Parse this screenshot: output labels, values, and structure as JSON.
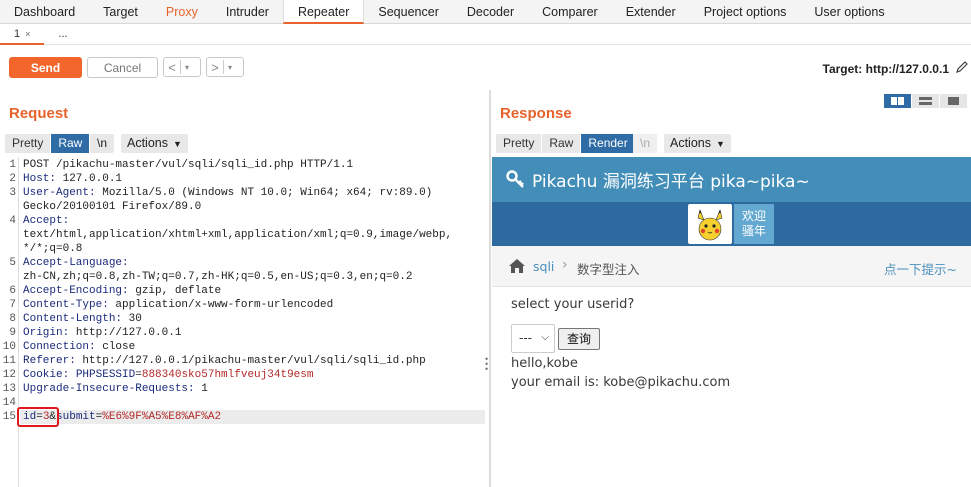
{
  "tabs": [
    {
      "label": "Dashboard",
      "state": "normal"
    },
    {
      "label": "Target",
      "state": "normal"
    },
    {
      "label": "Proxy",
      "state": "highlight"
    },
    {
      "label": "Intruder",
      "state": "normal"
    },
    {
      "label": "Repeater",
      "state": "active"
    },
    {
      "label": "Sequencer",
      "state": "normal"
    },
    {
      "label": "Decoder",
      "state": "normal"
    },
    {
      "label": "Comparer",
      "state": "normal"
    },
    {
      "label": "Extender",
      "state": "normal"
    },
    {
      "label": "Project options",
      "state": "normal"
    },
    {
      "label": "User options",
      "state": "normal"
    }
  ],
  "subtabs": {
    "first": "1",
    "close": "×",
    "more": "..."
  },
  "toolbar": {
    "send": "Send",
    "cancel": "Cancel",
    "back": "<",
    "forward": ">",
    "dropdown": "▾",
    "target_label": "Target: http://127.0.0.1",
    "edit_icon": "pencil-icon"
  },
  "colors": {
    "accent": "#e8632b",
    "selected": "#2f6ba5",
    "highlight_box": "#e0181d"
  },
  "request": {
    "title": "Request",
    "view_modes": [
      "Pretty",
      "Raw"
    ],
    "active_mode": "Raw",
    "newline_toggle": "\\n",
    "actions": "Actions",
    "lines": [
      {
        "n": "1",
        "key": "",
        "sep": "",
        "value": "POST /pikachu-master/vul/sqli/sqli_id.php HTTP/1.1"
      },
      {
        "n": "2",
        "key": "Host",
        "sep": ": ",
        "value": "127.0.0.1"
      },
      {
        "n": "3",
        "key": "User-Agent",
        "sep": ": ",
        "value": "Mozilla/5.0 (Windows NT 10.0; Win64; x64; rv:89.0)"
      },
      {
        "n": "",
        "key": "",
        "sep": "",
        "value": "Gecko/20100101 Firefox/89.0"
      },
      {
        "n": "4",
        "key": "Accept",
        "sep": ":",
        "value": ""
      },
      {
        "n": "",
        "key": "",
        "sep": "",
        "value": "text/html,application/xhtml+xml,application/xml;q=0.9,image/webp,"
      },
      {
        "n": "",
        "key": "",
        "sep": "",
        "value": "*/*;q=0.8"
      },
      {
        "n": "5",
        "key": "Accept-Language",
        "sep": ":",
        "value": ""
      },
      {
        "n": "",
        "key": "",
        "sep": "",
        "value": "zh-CN,zh;q=0.8,zh-TW;q=0.7,zh-HK;q=0.5,en-US;q=0.3,en;q=0.2"
      },
      {
        "n": "6",
        "key": "Accept-Encoding",
        "sep": ": ",
        "value": "gzip, deflate"
      },
      {
        "n": "7",
        "key": "Content-Type",
        "sep": ": ",
        "value": "application/x-www-form-urlencoded"
      },
      {
        "n": "8",
        "key": "Content-Length",
        "sep": ": ",
        "value": "30"
      },
      {
        "n": "9",
        "key": "Origin",
        "sep": ": ",
        "value": "http://127.0.0.1"
      },
      {
        "n": "10",
        "key": "Connection",
        "sep": ": ",
        "value": "close"
      },
      {
        "n": "11",
        "key": "Referer",
        "sep": ": ",
        "value": "http://127.0.0.1/pikachu-master/vul/sqli/sqli_id.php"
      },
      {
        "n": "12",
        "key": "Cookie",
        "sep": ": ",
        "value": "",
        "cookie_name": "PHPSESSID",
        "cookie_eq": "=",
        "cookie_val": "888340sko57hmlfveuj34t9esm"
      },
      {
        "n": "13",
        "key": "Upgrade-Insecure-Requests",
        "sep": ": ",
        "value": "1"
      },
      {
        "n": "14",
        "key": "",
        "sep": "",
        "value": ""
      },
      {
        "n": "15",
        "key": "",
        "sep": "",
        "value": "",
        "body": {
          "p1": "id",
          "eq1": "=",
          "v1": "3",
          "amp": "&",
          "p2": "submit",
          "eq2": "=",
          "v2": "%E6%9F%A5%E8%AF%A2"
        }
      }
    ]
  },
  "response": {
    "title": "Response",
    "view_modes": [
      "Pretty",
      "Raw",
      "Render"
    ],
    "active_mode": "Render",
    "newline_toggle": "\\n",
    "actions": "Actions",
    "layout_icons": [
      "columns-icon",
      "rows-icon",
      "single-icon"
    ],
    "page": {
      "title": "Pikachu 漏洞练习平台 pika~pika~",
      "logo_icon": "key-icon",
      "avatar_icon": "pikachu-avatar-icon",
      "welcome": [
        "欢迎",
        "骚年"
      ],
      "home_icon": "home-icon",
      "breadcrumb_link": "sqli",
      "breadcrumb_sep": "›",
      "breadcrumb_current": "数字型注入",
      "hint_link": "点一下提示~",
      "question": "select your userid?",
      "select_value": "---",
      "submit_label": "查询",
      "result_line1": "hello,kobe",
      "result_line2": "your email is: kobe@pikachu.com"
    }
  }
}
